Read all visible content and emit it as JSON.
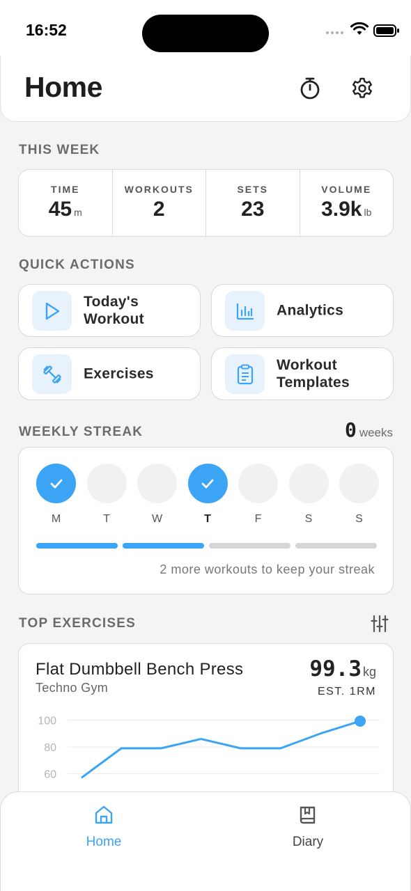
{
  "status_bar": {
    "time": "16:52"
  },
  "header": {
    "title": "Home"
  },
  "this_week": {
    "title": "THIS WEEK",
    "stats": [
      {
        "label": "TIME",
        "value": "45",
        "unit": "m"
      },
      {
        "label": "WORKOUTS",
        "value": "2",
        "unit": ""
      },
      {
        "label": "SETS",
        "value": "23",
        "unit": ""
      },
      {
        "label": "VOLUME",
        "value": "3.9k",
        "unit": "lb"
      }
    ]
  },
  "quick_actions": {
    "title": "QUICK ACTIONS",
    "items": [
      {
        "label": "Today's Workout",
        "icon": "play-icon"
      },
      {
        "label": "Analytics",
        "icon": "bar-chart-icon"
      },
      {
        "label": "Exercises",
        "icon": "dumbbell-icon"
      },
      {
        "label": "Workout Templates",
        "icon": "clipboard-icon"
      }
    ]
  },
  "streak": {
    "title": "WEEKLY STREAK",
    "count": "0",
    "count_unit": "weeks",
    "days": [
      {
        "letter": "M",
        "done": true,
        "today": false
      },
      {
        "letter": "T",
        "done": false,
        "today": false
      },
      {
        "letter": "W",
        "done": false,
        "today": false
      },
      {
        "letter": "T",
        "done": true,
        "today": true
      },
      {
        "letter": "F",
        "done": false,
        "today": false
      },
      {
        "letter": "S",
        "done": false,
        "today": false
      },
      {
        "letter": "S",
        "done": false,
        "today": false
      }
    ],
    "progress_filled": 2,
    "progress_total": 4,
    "message": "2 more workouts to keep your streak"
  },
  "top_exercises": {
    "title": "TOP EXERCISES",
    "exercise": {
      "name": "Flat Dumbbell Bench Press",
      "gym": "Techno Gym",
      "value": "99.3",
      "unit": "kg",
      "metric": "EST. 1RM"
    }
  },
  "chart_data": {
    "type": "line",
    "y_ticks": [
      "100",
      "80",
      "60"
    ],
    "ylim": [
      53,
      105
    ],
    "values": [
      57,
      79,
      79,
      86,
      79,
      79,
      90,
      99.3
    ],
    "line_color": "#3ba4f4"
  },
  "bottom_nav": {
    "items": [
      {
        "label": "Home",
        "icon": "home-icon",
        "active": true
      },
      {
        "label": "Diary",
        "icon": "book-icon",
        "active": false
      }
    ]
  },
  "colors": {
    "accent": "#3ba4f4",
    "accent_light": "#e7f2fd",
    "background": "#f4f4f5"
  }
}
